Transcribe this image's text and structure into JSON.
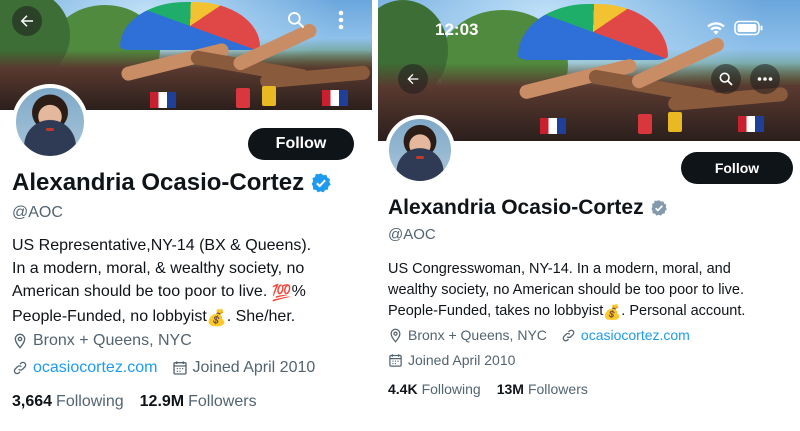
{
  "left": {
    "name": "Alexandria Ocasio-Cortez",
    "handle": "@AOC",
    "follow_label": "Follow",
    "bio_lines": [
      "US Representative,NY-14 (BX & Queens).",
      "In a modern, moral, & wealthy society, no",
      "American should be too poor to live. ",
      "People-Funded, no lobbyist",
      ". She/her."
    ],
    "hundred_emoji": "💯",
    "percent": "%",
    "moneybag_emoji": "💰",
    "location": "Bronx + Queens, NYC",
    "website": "ocasiocortez.com",
    "joined": "Joined April 2010",
    "following_count": "3,664",
    "following_label": "Following",
    "followers_count": "12.9M",
    "followers_label": "Followers",
    "icons": [
      "back-arrow-icon",
      "search-icon",
      "more-vertical-icon",
      "verified-badge-icon",
      "location-pin-icon",
      "link-icon",
      "calendar-icon"
    ]
  },
  "right": {
    "status_time": "12:03",
    "name": "Alexandria Ocasio-Cortez",
    "handle": "@AOC",
    "follow_label": "Follow",
    "bio_line1": "US Congresswoman, NY-14. In a modern, moral, and",
    "bio_line2": "wealthy society, no American should be too poor to live.",
    "bio_line3_a": "People-Funded, takes no lobbyist",
    "moneybag_emoji": "💰",
    "bio_line3_b": ". Personal account.",
    "location": "Bronx + Queens, NYC",
    "website": "ocasiocortez.com",
    "joined": "Joined April 2010",
    "following_count": "4.4K",
    "following_label": "Following",
    "followers_count": "13M",
    "followers_label": "Followers",
    "icons": [
      "wifi-icon",
      "battery-icon",
      "back-arrow-icon",
      "search-icon",
      "more-horizontal-icon",
      "verified-badge-icon",
      "location-pin-icon",
      "link-icon",
      "calendar-icon"
    ]
  },
  "colors": {
    "text_primary": "#0f1419",
    "text_secondary": "#536471",
    "link": "#1d9bf0",
    "verified_left": "#1d9bf0",
    "verified_right": "#829aab",
    "follow_button": "#0f1419"
  }
}
